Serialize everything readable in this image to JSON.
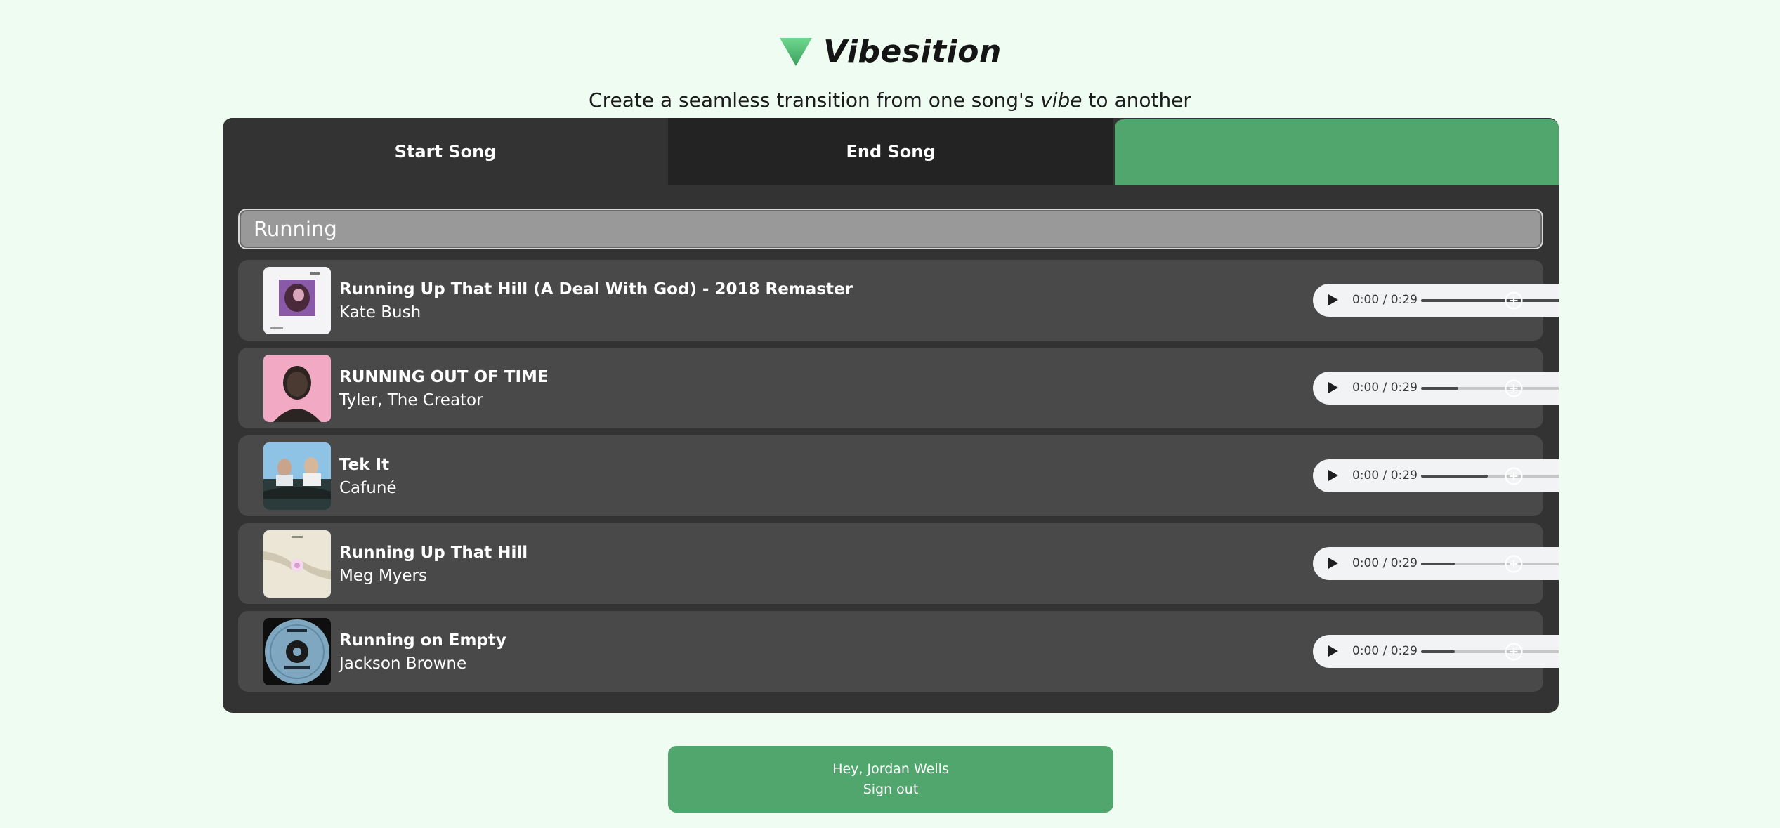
{
  "app": {
    "name": "Vibesition",
    "tagline_before": "Create a seamless transition from one song's ",
    "tagline_emph": "vibe",
    "tagline_after": " to another",
    "logo_icon": "green-down-triangle",
    "accent_color": "#50a66d"
  },
  "tabs": {
    "start": "Start Song",
    "end": "End Song",
    "go": ""
  },
  "search": {
    "value": "Running"
  },
  "results": [
    {
      "title": "Running Up That Hill (A Deal With God) - 2018 Remaster",
      "artist": "Kate Bush",
      "time": "0:00 / 0:29",
      "progress": 1.0
    },
    {
      "title": "RUNNING OUT OF TIME",
      "artist": "Tyler, The Creator",
      "time": "0:00 / 0:29",
      "progress": 0.2
    },
    {
      "title": "Tek It",
      "artist": "Cafuné",
      "time": "0:00 / 0:29",
      "progress": 0.36
    },
    {
      "title": "Running Up That Hill",
      "artist": "Meg Myers",
      "time": "0:00 / 0:29",
      "progress": 0.18
    },
    {
      "title": "Running on Empty",
      "artist": "Jackson Browne",
      "time": "0:00 / 0:29",
      "progress": 0.18
    }
  ],
  "user": {
    "greeting": "Hey, Jordan Wells",
    "signout": "Sign out"
  }
}
